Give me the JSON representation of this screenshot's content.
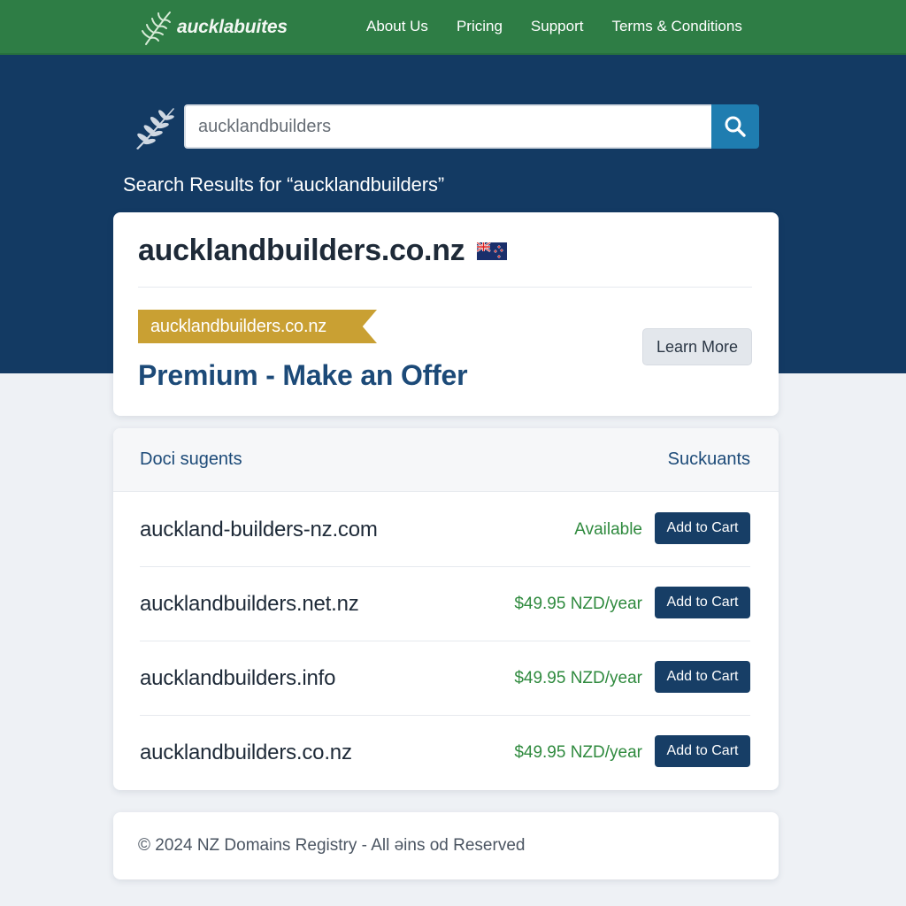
{
  "header": {
    "brand_name": "aucklabuites",
    "nav": [
      "About Us",
      "Pricing",
      "Support",
      "Terms & Conditions"
    ]
  },
  "search": {
    "query": "aucklandbuilders",
    "results_heading": "Search Results for “aucklandbuilders”"
  },
  "featured": {
    "domain": "aucklandbuilders.co.nz",
    "flag_icon": "nz-flag-icon",
    "ribbon_text": "aucklandbuilders.co.nz",
    "premium_text": "Premium - Make an Offer",
    "learn_more_label": "Learn More"
  },
  "suggestions": {
    "header_left": "Doci sugents",
    "header_right": "Suckuants",
    "cart_label": "Add to Cart",
    "rows": [
      {
        "domain": "auckland-builders-nz.com",
        "status": "Available"
      },
      {
        "domain": "aucklandbuilders.net.nz",
        "status": "$49.95 NZD/year"
      },
      {
        "domain": "aucklandbuilders.info",
        "status": "$49.95 NZD/year"
      },
      {
        "domain": "aucklandbuilders.co.nz",
        "status": "$49.95 NZD/year"
      }
    ]
  },
  "footer": {
    "text": "© 2024 NZ Domains Registry - All əins od Reserved"
  },
  "colors": {
    "nav_bg": "#2e7d45",
    "hero_bg": "#133a63",
    "search_button": "#1f7db0",
    "ribbon": "#c9a033",
    "premium_text": "#1c4a78",
    "status_green": "#2f8a3e",
    "cart_button": "#173e66"
  }
}
